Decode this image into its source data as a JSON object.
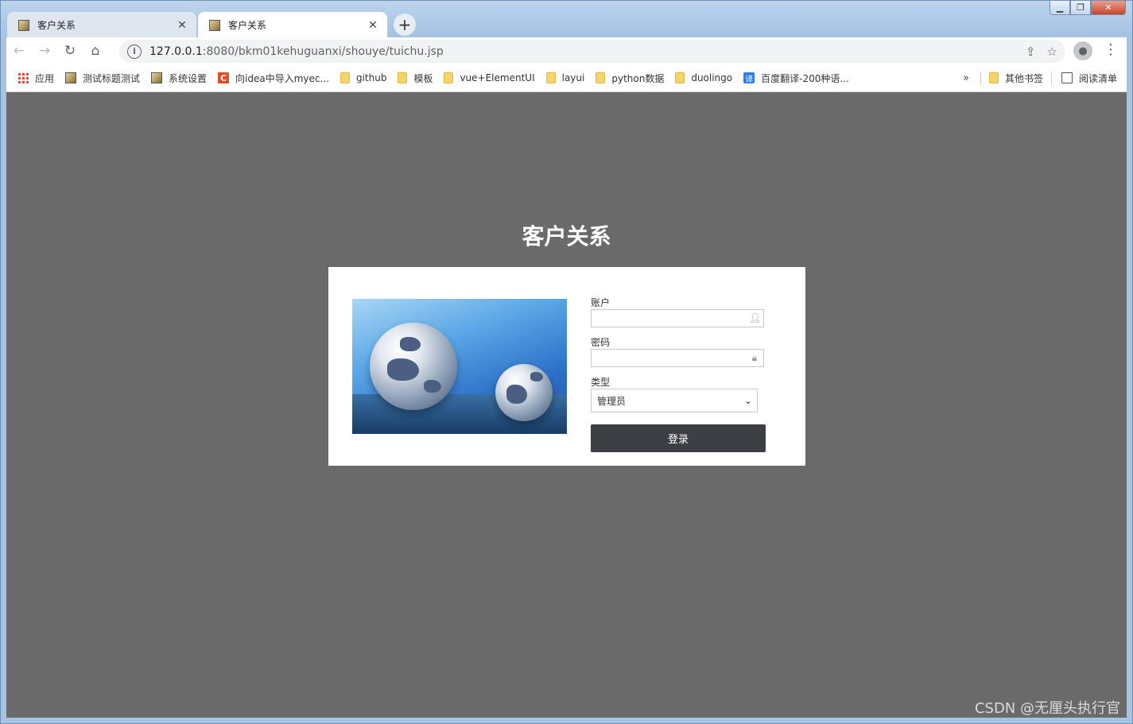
{
  "window": {
    "controls": {
      "minimize": "▁",
      "maximize": "❐",
      "close": "✕"
    }
  },
  "tabs": [
    {
      "title": "客户关系",
      "close": "✕",
      "active": false
    },
    {
      "title": "客户关系",
      "close": "✕",
      "active": true
    }
  ],
  "new_tab": "+",
  "toolbar": {
    "back": "←",
    "forward": "→",
    "reload": "↻",
    "home": "⌂",
    "url_host": "127.0.0.1",
    "url_path": ":8080/bkm01kehuguanxi/shouye/tuichu.jsp",
    "share_icon": "⇪",
    "star_icon": "☆",
    "menu": "⋮"
  },
  "bookmarks": [
    {
      "label": "应用",
      "icon": "apps"
    },
    {
      "label": "测试标题测试",
      "icon": "img"
    },
    {
      "label": "系统设置",
      "icon": "img"
    },
    {
      "label": "向idea中导入myec...",
      "icon": "c"
    },
    {
      "label": "github",
      "icon": "folder"
    },
    {
      "label": "模板",
      "icon": "folder"
    },
    {
      "label": "vue+ElementUI",
      "icon": "folder"
    },
    {
      "label": "layui",
      "icon": "folder"
    },
    {
      "label": "python数据",
      "icon": "folder"
    },
    {
      "label": "duolingo",
      "icon": "folder"
    },
    {
      "label": "百度翻译-200种语...",
      "icon": "yi"
    }
  ],
  "bookmarks_more": "»",
  "bookmarks_right": [
    {
      "label": "其他书签",
      "icon": "folder"
    },
    {
      "label": "阅读清单",
      "icon": "list"
    }
  ],
  "page": {
    "title": "客户关系",
    "form": {
      "account_label": "账户",
      "account_value": "",
      "password_label": "密码",
      "password_value": "",
      "type_label": "类型",
      "type_selected": "管理员",
      "login_button": "登录"
    }
  },
  "watermark": "CSDN @无厘头执行官",
  "colors": {
    "page_bg": "#6a6a6a",
    "button_bg": "#3c3f44"
  }
}
